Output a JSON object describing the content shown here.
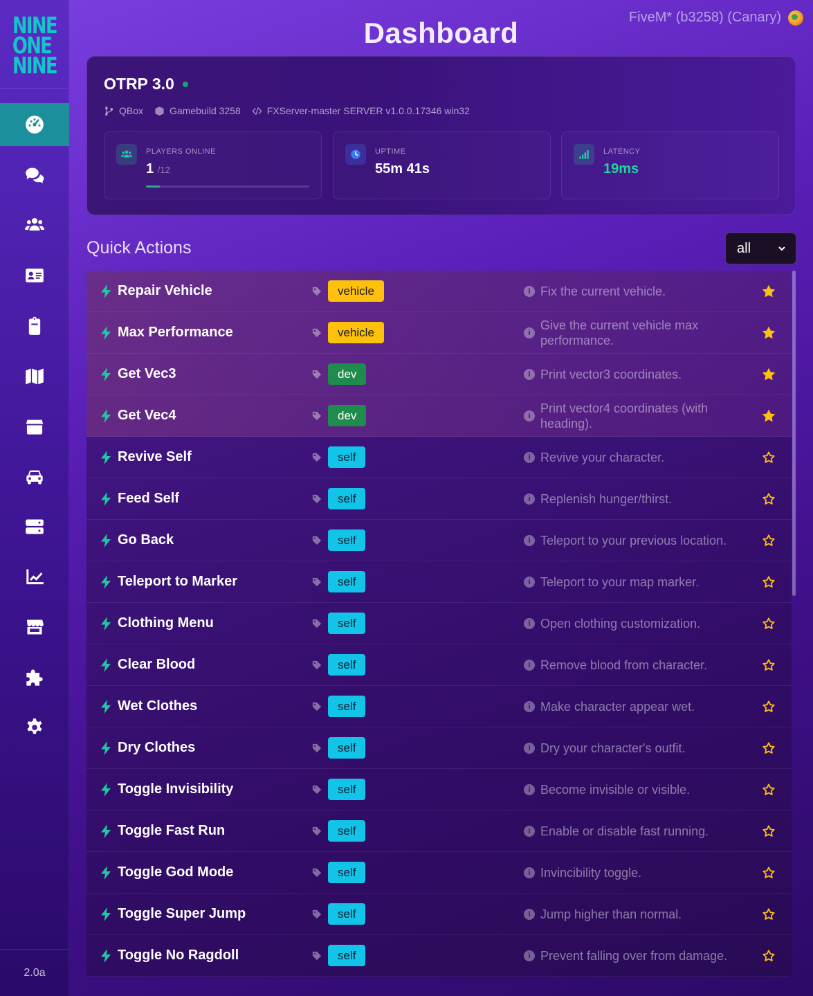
{
  "sidebar": {
    "logo_lines": [
      "NINE",
      "ONE",
      "NINE"
    ],
    "items": [
      {
        "name": "dashboard",
        "icon": "dashboard-gauge-icon",
        "active": true
      },
      {
        "name": "chat",
        "icon": "chat-bubbles-icon",
        "active": false
      },
      {
        "name": "players",
        "icon": "users-icon",
        "active": false
      },
      {
        "name": "identity",
        "icon": "id-card-icon",
        "active": false
      },
      {
        "name": "reports",
        "icon": "clipboard-icon",
        "active": false
      },
      {
        "name": "map",
        "icon": "map-icon",
        "active": false
      },
      {
        "name": "inventory",
        "icon": "box-icon",
        "active": false
      },
      {
        "name": "vehicles",
        "icon": "car-icon",
        "active": false
      },
      {
        "name": "server",
        "icon": "server-icon",
        "active": false
      },
      {
        "name": "stats",
        "icon": "chart-line-icon",
        "active": false
      },
      {
        "name": "shop",
        "icon": "store-icon",
        "active": false
      },
      {
        "name": "resources",
        "icon": "puzzle-icon",
        "active": false
      },
      {
        "name": "settings",
        "icon": "gear-icon",
        "active": false
      }
    ],
    "version": "2.0a"
  },
  "header": {
    "title": "Dashboard",
    "build": "FiveM* (b3258) (Canary)"
  },
  "server": {
    "name": "OTRP 3.0",
    "framework": "QBox",
    "gamebuild": "Gamebuild 3258",
    "server_version": "FXServer-master SERVER v1.0.0.17346 win32",
    "stats": {
      "players": {
        "label": "PLAYERS ONLINE",
        "value": "1",
        "max": "/12",
        "fill_fraction": 0.083
      },
      "uptime": {
        "label": "UPTIME",
        "value": "55m 41s"
      },
      "latency": {
        "label": "LATENCY",
        "value": "19ms"
      }
    },
    "colors": {
      "accent_teal": "#22c7a0",
      "uptime_blue": "#3b7bf0",
      "latency_green": "#22d39a"
    }
  },
  "quick_actions": {
    "title": "Quick Actions",
    "filter": {
      "selected": "all"
    },
    "items": [
      {
        "name": "Repair Vehicle",
        "tag": "vehicle",
        "description": "Fix the current vehicle.",
        "favorite": true
      },
      {
        "name": "Max Performance",
        "tag": "vehicle",
        "description": "Give the current vehicle max performance.",
        "favorite": true
      },
      {
        "name": "Get Vec3",
        "tag": "dev",
        "description": "Print vector3 coordinates.",
        "favorite": true
      },
      {
        "name": "Get Vec4",
        "tag": "dev",
        "description": "Print vector4 coordinates (with heading).",
        "favorite": true
      },
      {
        "name": "Revive Self",
        "tag": "self",
        "description": "Revive your character.",
        "favorite": false
      },
      {
        "name": "Feed Self",
        "tag": "self",
        "description": "Replenish hunger/thirst.",
        "favorite": false
      },
      {
        "name": "Go Back",
        "tag": "self",
        "description": "Teleport to your previous location.",
        "favorite": false
      },
      {
        "name": "Teleport to Marker",
        "tag": "self",
        "description": "Teleport to your map marker.",
        "favorite": false
      },
      {
        "name": "Clothing Menu",
        "tag": "self",
        "description": "Open clothing customization.",
        "favorite": false
      },
      {
        "name": "Clear Blood",
        "tag": "self",
        "description": "Remove blood from character.",
        "favorite": false
      },
      {
        "name": "Wet Clothes",
        "tag": "self",
        "description": "Make character appear wet.",
        "favorite": false
      },
      {
        "name": "Dry Clothes",
        "tag": "self",
        "description": "Dry your character's outfit.",
        "favorite": false
      },
      {
        "name": "Toggle Invisibility",
        "tag": "self",
        "description": "Become invisible or visible.",
        "favorite": false
      },
      {
        "name": "Toggle Fast Run",
        "tag": "self",
        "description": "Enable or disable fast running.",
        "favorite": false
      },
      {
        "name": "Toggle God Mode",
        "tag": "self",
        "description": "Invincibility toggle.",
        "favorite": false
      },
      {
        "name": "Toggle Super Jump",
        "tag": "self",
        "description": "Jump higher than normal.",
        "favorite": false
      },
      {
        "name": "Toggle No Ragdoll",
        "tag": "self",
        "description": "Prevent falling over from damage.",
        "favorite": false
      }
    ]
  },
  "colors": {
    "tag_vehicle": "#fdc10b",
    "tag_dev": "#1f8b4c",
    "tag_self": "#12c5e8",
    "star": "#fdc10b",
    "active_nav": "#1b8f9c"
  }
}
